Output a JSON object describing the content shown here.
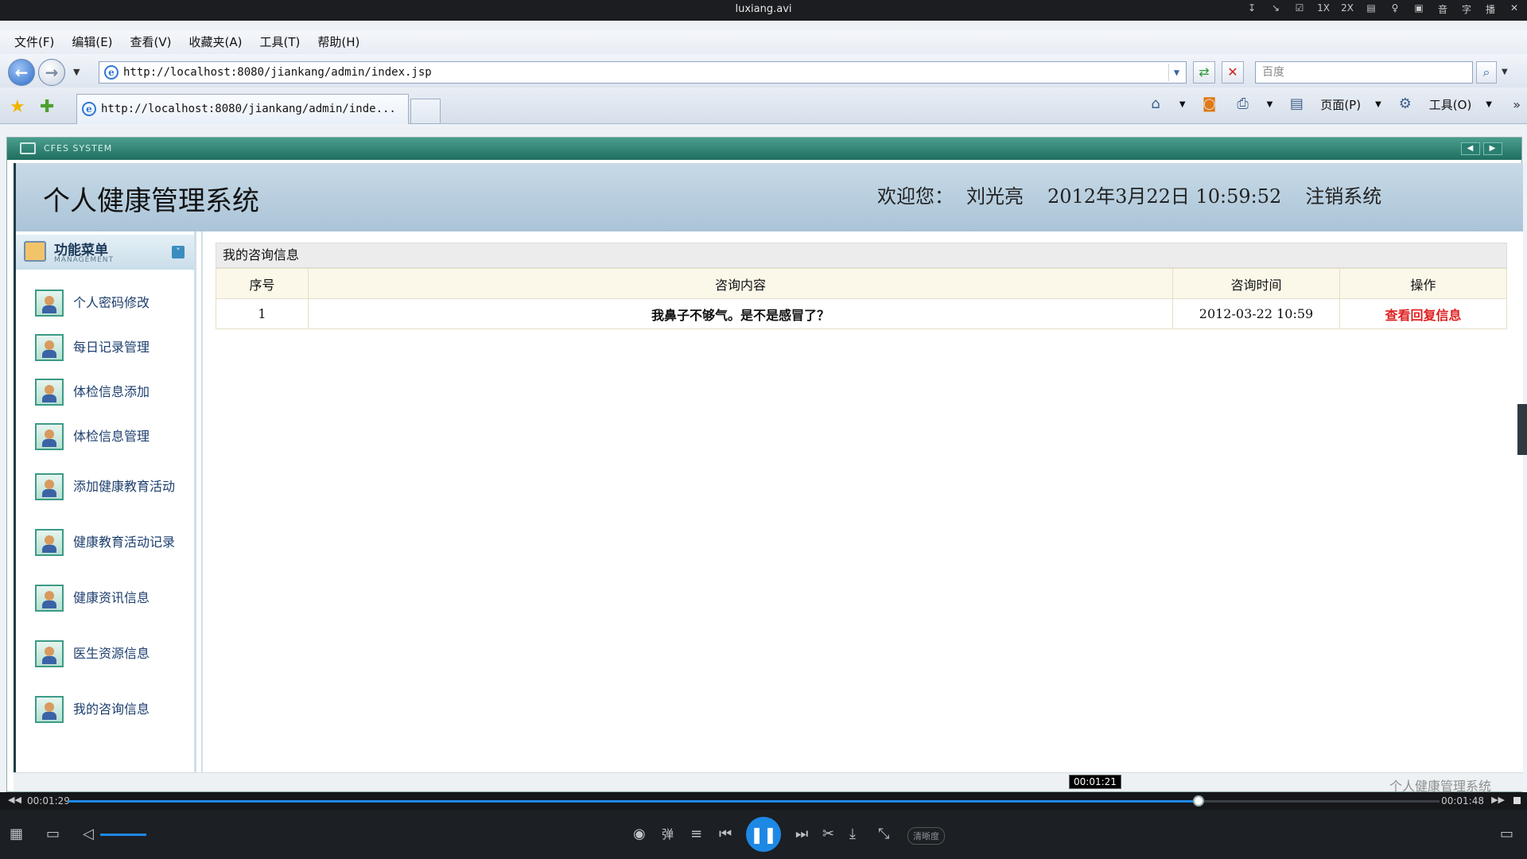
{
  "player": {
    "title": "luxiang.avi",
    "top_icons": [
      "↧",
      "↘",
      "☑",
      "1X",
      "2X",
      "▤",
      "♀",
      "▣",
      "音",
      "字",
      "播",
      "✕"
    ],
    "time_elapsed": "00:01:29",
    "time_total": "00:01:48",
    "hover_time": "00:01:21",
    "progress": 0.8243,
    "quality_label": "清晰度"
  },
  "browser": {
    "menu": [
      "文件(F)",
      "编辑(E)",
      "查看(V)",
      "收藏夹(A)",
      "工具(T)",
      "帮助(H)"
    ],
    "url": "http://localhost:8080/jiankang/admin/index.jsp",
    "search_placeholder": "百度",
    "tab_title": "http://localhost:8080/jiankang/admin/inde...",
    "page_menu": "页面(P)",
    "tools_menu": "工具(O)"
  },
  "app": {
    "system_label": "CFES SYSTEM",
    "title": "个人健康管理系统",
    "welcome_label": "欢迎您：",
    "user_name": "刘光亮",
    "datetime": "2012年3月22日  10:59:52",
    "logout": "注销系统",
    "menu_title": "功能菜单",
    "menu_subtitle": "MANAGEMENT",
    "menu_items": [
      "个人密码修改",
      "每日记录管理",
      "体检信息添加",
      "体检信息管理",
      "添加健康教育活动",
      "健康教育活动记录",
      "健康资讯信息",
      "医生资源信息",
      "我的咨询信息"
    ],
    "footer": "个人健康管理系统"
  },
  "consult": {
    "caption": "我的咨询信息",
    "headers": [
      "序号",
      "咨询内容",
      "咨询时间",
      "操作"
    ],
    "rows": [
      {
        "index": "1",
        "content": "我鼻子不够气。是不是感冒了？",
        "time": "2012-03-22 10:59",
        "action": "查看回复信息"
      }
    ]
  }
}
